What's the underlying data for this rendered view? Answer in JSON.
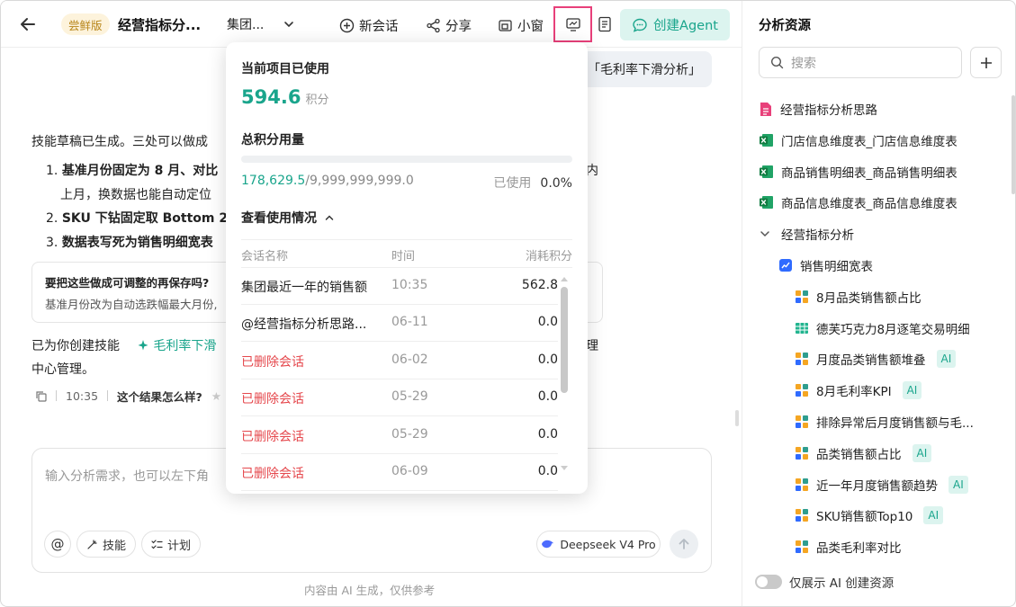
{
  "header": {
    "back_icon": "arrow-left-icon",
    "trial_badge": "尝鲜版",
    "doc_title": "经营指标分...",
    "group_select": "集团...",
    "new_chat": "新会话",
    "share": "分享",
    "small_window": "小窗",
    "create_agent": "创建Agent",
    "accent_color": "#1aa58c",
    "highlight_color": "#e8407a"
  },
  "chat": {
    "user_message": "「毛利率下滑分析」",
    "reply_intro": "技能草稿已生成。三处可以做成",
    "reply_items": [
      {
        "num": "1.",
        "bold": "基准月份固定为 8 月、对比",
        "extra": "上月，换数据也能自动定位"
      },
      {
        "num": "2.",
        "bold": "SKU 下钻固定取 Bottom 2",
        "extra": ""
      },
      {
        "num": "3.",
        "bold": "数据表写死为销售明细宽表",
        "extra": ""
      }
    ],
    "reply_tail_1": "内",
    "tip_title": "要把这些做成可调整的再保存吗?",
    "tip_desc": "基准月份改为自动选跌幅最大月份,",
    "skill_prefix": "已为你创建技能",
    "skill_link": "毛利率下滑",
    "skill_suffix": "中心管理。",
    "skill_tail": "理",
    "time": "10:35",
    "feedback": "这个结果怎么样?"
  },
  "input": {
    "placeholder": "输入分析需求，也可以左下角",
    "at_label": "@",
    "skill_chip": "技能",
    "plan_chip": "计划",
    "model": "Deepseek V4 Pro",
    "footnote": "内容由 AI 生成，仅供参考"
  },
  "popover": {
    "current_label": "当前项目已使用",
    "current_value": "594.6",
    "current_unit": "积分",
    "total_label": "总积分用量",
    "used": "178,629.5",
    "total": "/9,999,999,999.0",
    "used_label": "已使用",
    "used_pct": "0.0%",
    "used_fraction": 0.0,
    "toggle_label": "查看使用情况",
    "columns": {
      "name": "会话名称",
      "time": "时间",
      "cost": "消耗积分"
    },
    "rows": [
      {
        "name": "集团最近一年的销售额",
        "time": "10:35",
        "cost": "562.8",
        "deleted": false
      },
      {
        "name": "@经营指标分析思路...",
        "time": "06-11",
        "cost": "0.0",
        "deleted": false
      },
      {
        "name": "已删除会话",
        "time": "06-02",
        "cost": "0.0",
        "deleted": true
      },
      {
        "name": "已删除会话",
        "time": "05-29",
        "cost": "0.0",
        "deleted": true
      },
      {
        "name": "已删除会话",
        "time": "05-29",
        "cost": "0.0",
        "deleted": true
      },
      {
        "name": "已删除会话",
        "time": "06-09",
        "cost": "0.0",
        "deleted": true
      }
    ]
  },
  "resources": {
    "title": "分析资源",
    "search_placeholder": "搜索",
    "items": [
      {
        "label": "经营指标分析思路",
        "icon": "doc-pink-icon",
        "ai": false,
        "indent": 0
      },
      {
        "label": "门店信息维度表_门店信息维度表",
        "icon": "excel-icon",
        "ai": false,
        "indent": 0
      },
      {
        "label": "商品销售明细表_商品销售明细表",
        "icon": "excel-icon",
        "ai": false,
        "indent": 0
      },
      {
        "label": "商品信息维度表_商品信息维度表",
        "icon": "excel-icon",
        "ai": false,
        "indent": 0
      },
      {
        "label": "经营指标分析",
        "icon": "chevron-down-icon",
        "ai": false,
        "indent": 0
      },
      {
        "label": "销售明细宽表",
        "icon": "dataset-icon",
        "ai": false,
        "indent": 1
      },
      {
        "label": "8月品类销售额占比",
        "icon": "chart-icon",
        "ai": false,
        "indent": 2
      },
      {
        "label": "德芙巧克力8月逐笔交易明细",
        "icon": "table-icon",
        "ai": false,
        "indent": 2
      },
      {
        "label": "月度品类销售额堆叠",
        "icon": "chart-icon",
        "ai": true,
        "indent": 2
      },
      {
        "label": "8月毛利率KPI",
        "icon": "chart-icon",
        "ai": true,
        "indent": 2
      },
      {
        "label": "排除异常后月度销售额与毛...",
        "icon": "chart-icon",
        "ai": false,
        "indent": 2
      },
      {
        "label": "品类销售额占比",
        "icon": "chart-icon",
        "ai": true,
        "indent": 2
      },
      {
        "label": "近一年月度销售额趋势",
        "icon": "chart-icon",
        "ai": true,
        "indent": 2
      },
      {
        "label": "SKU销售额Top10",
        "icon": "chart-icon",
        "ai": true,
        "indent": 2
      },
      {
        "label": "品类毛利率对比",
        "icon": "chart-icon",
        "ai": false,
        "indent": 2
      }
    ],
    "ai_badge": "AI",
    "toggle_label": "仅展示 AI 创建资源"
  }
}
